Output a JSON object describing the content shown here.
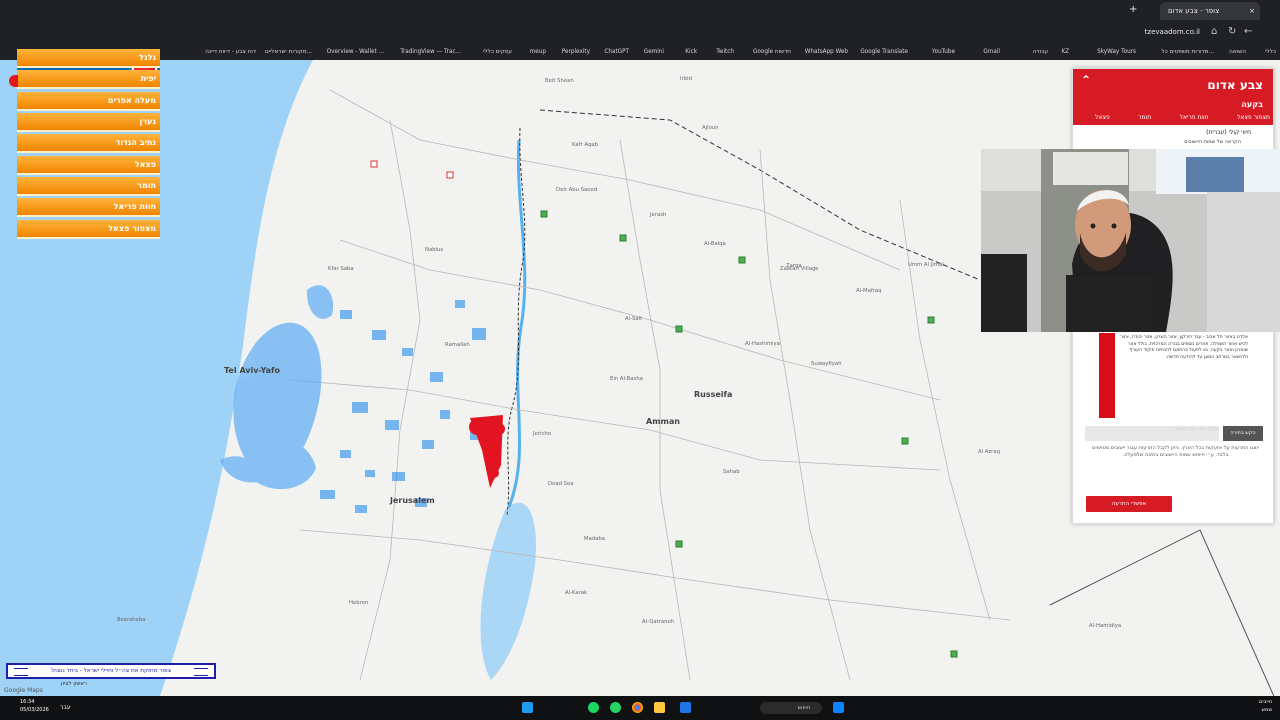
{
  "browser": {
    "tabs": [
      {
        "title": "צופר - צבע אדום",
        "close": "×"
      }
    ],
    "new_tab": "+",
    "address": "tzevaadom.co.il",
    "bookmarks": [
      "כללי",
      "השואה",
      "מדורות משפטים כל...",
      "SkyWay Tours",
      "KZ",
      "עבודה",
      "Gmail",
      "YouTube",
      "Google Translate",
      "WhatsApp Web",
      "Google חדשות",
      "Twitch",
      "Kick",
      "Gemini",
      "ChatGPT",
      "Perplexity",
      "meup",
      "עסקים כללי",
      "TradingView — Trac...",
      "Overview - Wallet ...",
      "מקורות ישראליים...",
      "דוח צבע - דיווח דיינה"
    ]
  },
  "alert_panel": {
    "title": "צופר - צבע אדום",
    "logo": "צ",
    "items": [
      "גלגל",
      "יפית",
      "מעלה אפרים",
      "נערן",
      "נתיב הגדוד",
      "פצאל",
      "תומר",
      "חוות פריאל",
      "מצפור פצאל"
    ]
  },
  "right_panel": {
    "title": "צבע אדום",
    "subtitle": "בקעה",
    "collapse": "⌃",
    "nav": [
      "מצפור פצאל",
      "חוות פריאל",
      "תומר",
      "פצאל"
    ],
    "setting": "חיווי קולי (עברית)",
    "small_note": "הקראה של שמות היישובים",
    "text_block": "אלרט באזור תל אביב - עבר הירקון, אזור השרון, אזור יהודה, אזור לכיש ואזור השפלה. אזורים נוספים בגזרה המרכזית, כולל אזור שומרון ואזור בקעה. נא לפעול בהתאם להנחיות פיקוד העורף ולהישאר במרחב המוגן עד להודעה חדשה.",
    "search_placeholder": "הקלד את שם היישוב",
    "search_button": "הקש בחירה",
    "note": "יוצגו התרעות על אזעקות בכל הארץ. ניתן לקבל התרעות עבור יישובים מסוימים בלבד, ע״י חיפוש שמות היישובים בתיבה שלמעלה.",
    "support_button": "אפשרי התרעה",
    "paypal": "PayPal"
  },
  "map": {
    "labels": [
      "Tel Aviv-Yafo",
      "Kafr Aqab",
      "Deir Abu Saeed",
      "Al-Balqa",
      "Al-Salt",
      "Ein Al-Basha",
      "Russeifa",
      "Amman",
      "Al-Hashimiya",
      "Zarqa",
      "Al-Mafraq",
      "Madaba",
      "Al-Karak",
      "Jericho",
      "Hebron",
      "Dead Sea",
      "Al-Qatraneh",
      "Al-Hamidiya",
      "Ajloun",
      "Jerash",
      "Suwayfiyah",
      "Sahab",
      "Al Azraq",
      "Zaatari Village",
      "Umm Al Jimal",
      "Irbid",
      "Beit Shean",
      "Kfar Saba",
      "Jerusalem",
      "Nablus",
      "Ramallah",
      "Beersheba"
    ]
  },
  "overlay": {
    "bottom_banner": "צופר מחזקת את צה״ל וחיילי ישראל - ביחד ננצח!",
    "bottom_small": "ראשון לציון",
    "google": "Google Maps"
  },
  "taskbar": {
    "time": "16:34",
    "date": "05/03/2026",
    "search": "חיפוש",
    "tray_left": "עבר",
    "tray_right_1": "חייבים",
    "tray_right_2": "שמש"
  }
}
